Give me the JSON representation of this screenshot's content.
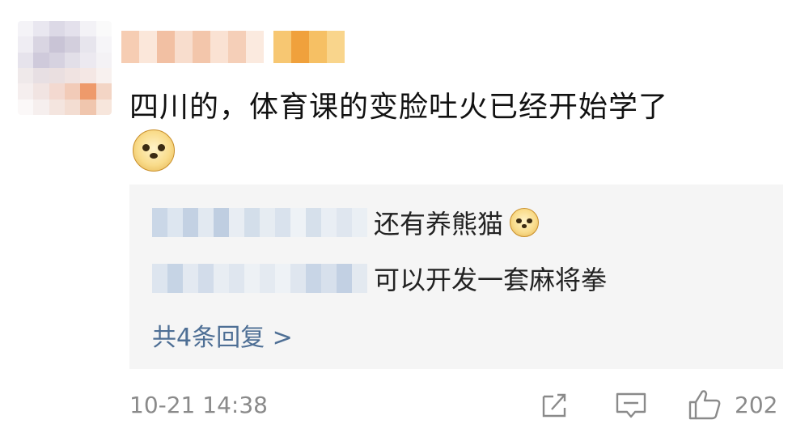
{
  "comment": {
    "text": "四川的，体育课的变脸吐火已经开始学了",
    "emoji": "doge-emoji",
    "timestamp": "10-21 14:38",
    "like_count": "202"
  },
  "replies": [
    {
      "text": "还有养熊猫",
      "emoji": "doge-emoji"
    },
    {
      "text": "可以开发一套麻将拳"
    }
  ],
  "more_replies_label": "共4条回复 >",
  "icons": {
    "share": "share-icon",
    "reply": "comment-icon",
    "like": "thumbs-up-icon"
  },
  "colors": {
    "link": "#4e6f95",
    "meta": "#8a8a8a",
    "reply_background": "#f5f5f5"
  }
}
